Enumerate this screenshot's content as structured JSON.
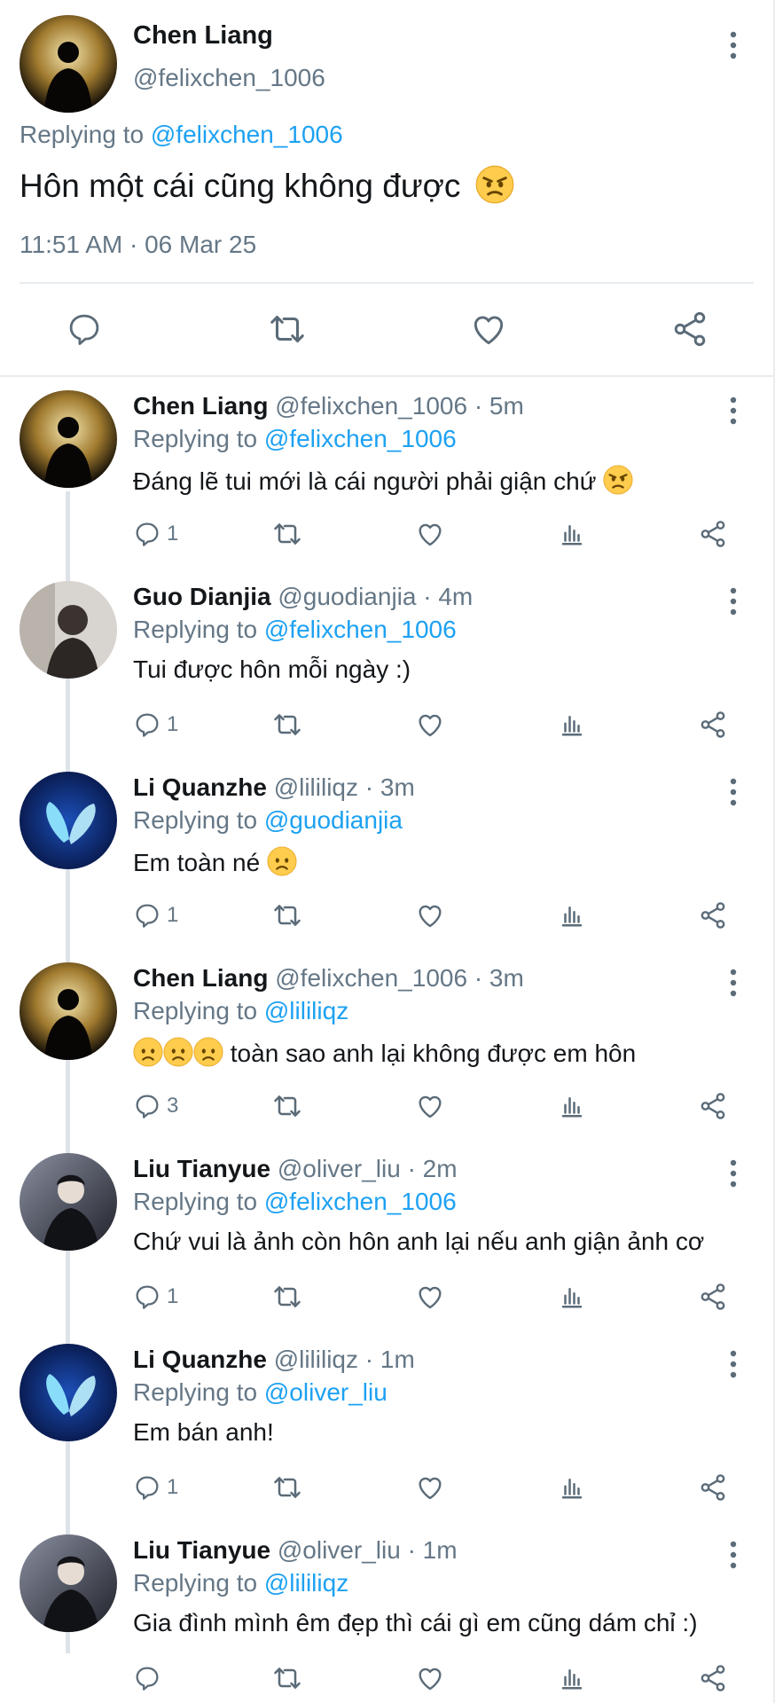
{
  "main": {
    "name": "Chen Liang",
    "handle": "@felixchen_1006",
    "replying_prefix": "Replying to ",
    "replying_mention": "@felixchen_1006",
    "text": "Hôn một cái cũng không được",
    "emoji": "angry-face",
    "timestamp": "11:51 AM · 06 Mar 25",
    "avatar": "dark-silhouette"
  },
  "replies": [
    {
      "name": "Chen Liang",
      "handle": "@felixchen_1006",
      "time": "5m",
      "replying_prefix": "Replying to ",
      "replying_mention": "@felixchen_1006",
      "text": "Đáng lẽ tui mới là cái người phải giận chứ",
      "emoji": "angry-face",
      "reply_count": "1",
      "avatar": "dark-silhouette"
    },
    {
      "name": "Guo Dianjia",
      "handle": "@guodianjia",
      "time": "4m",
      "replying_prefix": "Replying to ",
      "replying_mention": "@felixchen_1006",
      "text": "Tui được hôn mỗi ngày :)",
      "reply_count": "1",
      "avatar": "grey-portrait"
    },
    {
      "name": "Li Quanzhe",
      "handle": "@lililiqz",
      "time": "3m",
      "replying_prefix": "Replying to ",
      "replying_mention": "@guodianjia",
      "text": "Em toàn né",
      "emoji": "sad-face",
      "reply_count": "1",
      "avatar": "blue-butterfly"
    },
    {
      "name": "Chen Liang",
      "handle": "@felixchen_1006",
      "time": "3m",
      "replying_prefix": "Replying to ",
      "replying_mention": "@lililiqz",
      "text": "toàn sao anh lại không được em hôn",
      "emoji_prefix": "3x sad-face",
      "reply_count": "3",
      "avatar": "dark-silhouette"
    },
    {
      "name": "Liu Tianyue",
      "handle": "@oliver_liu",
      "time": "2m",
      "replying_prefix": "Replying to ",
      "replying_mention": "@felixchen_1006",
      "text": "Chứ vui là ảnh còn hôn anh lại nếu anh giận ảnh cơ",
      "reply_count": "1",
      "avatar": "dark-portrait"
    },
    {
      "name": "Li Quanzhe",
      "handle": "@lililiqz",
      "time": "1m",
      "replying_prefix": "Replying to ",
      "replying_mention": "@oliver_liu",
      "text": "Em bán anh!",
      "reply_count": "1",
      "avatar": "blue-butterfly"
    },
    {
      "name": "Liu Tianyue",
      "handle": "@oliver_liu",
      "time": "1m",
      "replying_prefix": "Replying to ",
      "replying_mention": "@lililiqz",
      "text": "Gia đình mình êm đẹp thì cái gì em cũng dám chỉ :)",
      "reply_count": "",
      "avatar": "dark-portrait"
    }
  ],
  "icons": {
    "reply": "reply-icon",
    "retweet": "retweet-icon",
    "like": "like-icon",
    "analytics": "analytics-icon",
    "share": "share-icon",
    "more": "more-vertical-icon"
  },
  "colors": {
    "link": "#1da1f2",
    "secondary_text": "#657786",
    "icon": "#5b6b78",
    "divider": "#e6ecf0",
    "thread_line": "#dde3e8"
  }
}
